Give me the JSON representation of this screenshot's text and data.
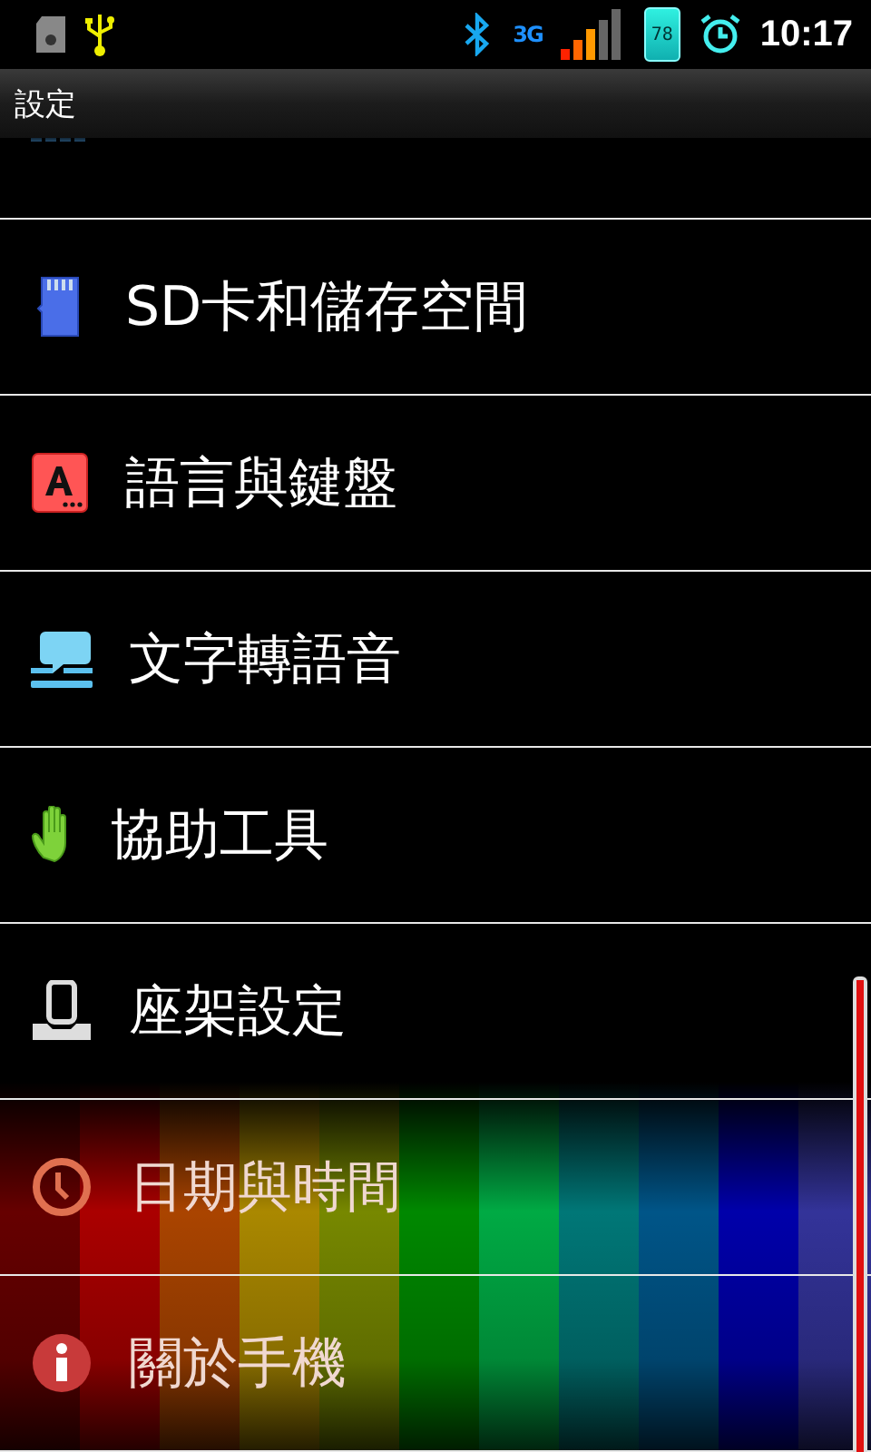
{
  "status_bar": {
    "network": "3G",
    "battery": "78",
    "time": "10:17"
  },
  "title": "設定",
  "settings": [
    {
      "label": "SD卡和儲存空間"
    },
    {
      "label": "語言與鍵盤"
    },
    {
      "label": "文字轉語音"
    },
    {
      "label": "協助工具"
    },
    {
      "label": "座架設定"
    },
    {
      "label": "日期與時間"
    },
    {
      "label": "關於手機"
    }
  ]
}
